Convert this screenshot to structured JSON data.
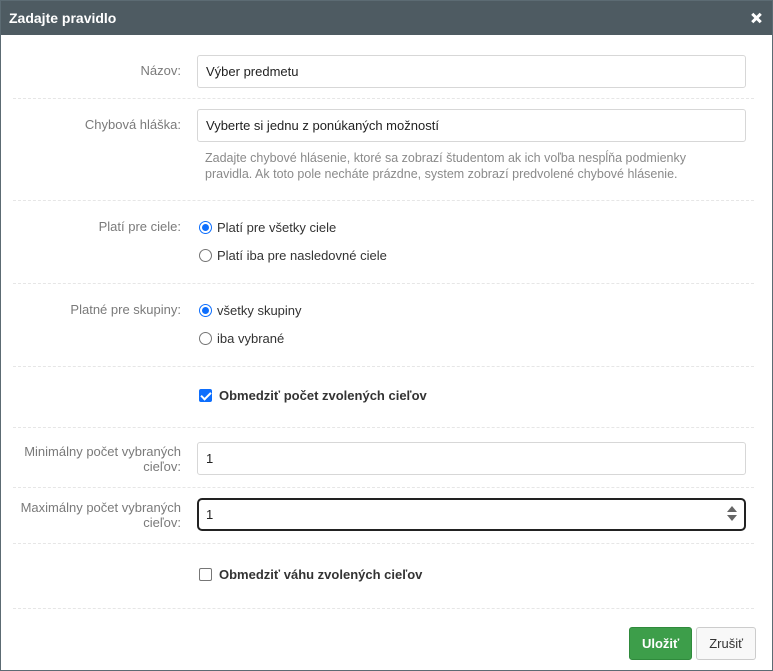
{
  "dialog": {
    "title": "Zadajte pravidlo"
  },
  "form": {
    "name": {
      "label": "Názov:",
      "value": "Výber predmetu"
    },
    "error_message": {
      "label": "Chybová hláška:",
      "value": "Vyberte si jednu z ponúkaných možností",
      "help": "Zadajte chybové hlásenie, ktoré sa zobrazí študentom ak ich voľba nespĺňa podmienky pravidla. Ak toto pole necháte prázdne, system zobrazí predvolené chybové hlásenie."
    },
    "targets": {
      "label": "Platí pre ciele:",
      "options": [
        {
          "label": "Platí pre všetky ciele",
          "checked": true
        },
        {
          "label": "Platí iba pre nasledovné ciele",
          "checked": false
        }
      ]
    },
    "groups": {
      "label": "Platné pre skupiny:",
      "options": [
        {
          "label": "všetky skupiny",
          "checked": true
        },
        {
          "label": "iba vybrané",
          "checked": false
        }
      ]
    },
    "limit_count": {
      "label": "Obmedziť počet zvolených cieľov",
      "checked": true
    },
    "min_count": {
      "label": "Minimálny počet vybraných cieľov:",
      "value": "1"
    },
    "max_count": {
      "label": "Maximálny počet vybraných cieľov:",
      "value": "1"
    },
    "limit_weight": {
      "label": "Obmedziť váhu zvolených cieľov",
      "checked": false
    }
  },
  "buttons": {
    "save": "Uložiť",
    "cancel": "Zrušiť"
  },
  "colors": {
    "titlebar": "#4e5b62",
    "primary": "#3d9e4a",
    "accent": "#0d6efd"
  }
}
